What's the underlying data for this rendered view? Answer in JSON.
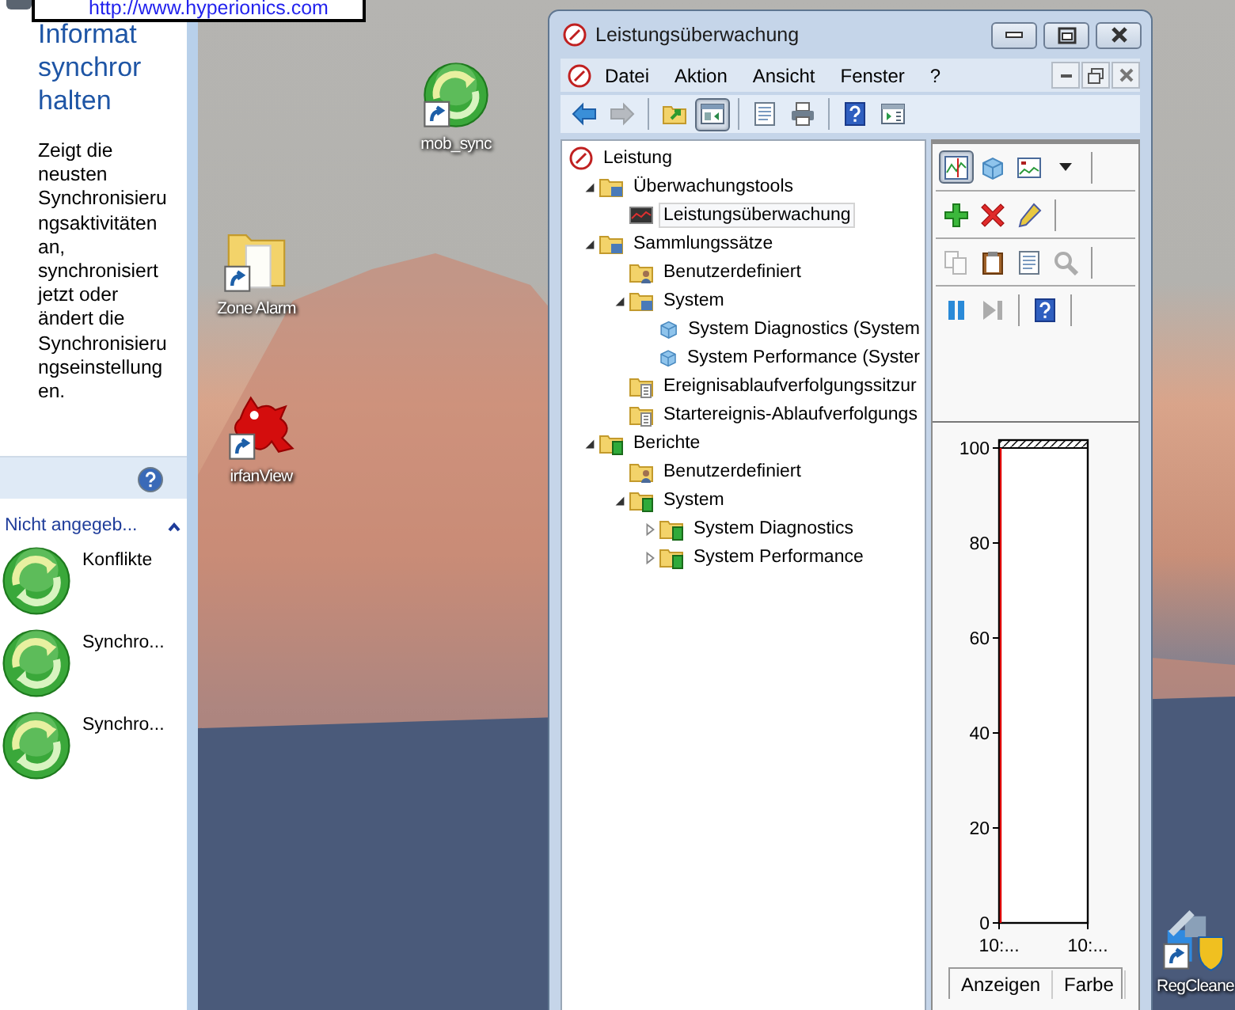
{
  "tooltip": {
    "text": "http://www.hyperionics.com"
  },
  "sync_panel": {
    "title": "Informat synchror halten",
    "description": "Zeigt die neusten Synchronisierungsaktivitäten an, synchronisiert jetzt oder ändert die Synchronisierungseinstellungen.",
    "group": {
      "label": "Nicht angegeb...",
      "expanded": true
    },
    "items": [
      {
        "label": "Konflikte"
      },
      {
        "label": "Synchro..."
      },
      {
        "label": "Synchro..."
      }
    ]
  },
  "desktop_icons": [
    {
      "label": "mob_sync",
      "kind": "sync"
    },
    {
      "label": "Zone Alarm",
      "kind": "folder"
    },
    {
      "label": "irfanView",
      "kind": "cat"
    },
    {
      "label": "RegCleane",
      "kind": "tools"
    }
  ],
  "window": {
    "title": "Leistungsüberwachung",
    "menu": [
      "Datei",
      "Aktion",
      "Ansicht",
      "Fenster",
      "?"
    ],
    "toolbar": [
      {
        "groups": [
          {
            "buttons": [
              {
                "kind": "back",
                "disabled": false,
                "pressed": false
              },
              {
                "kind": "forward",
                "disabled": true,
                "pressed": false
              }
            ]
          },
          {
            "buttons": [
              {
                "kind": "folderup",
                "disabled": false,
                "pressed": false
              },
              {
                "kind": "pane",
                "disabled": false,
                "pressed": true
              }
            ]
          },
          {
            "buttons": [
              {
                "kind": "doc",
                "disabled": false,
                "pressed": false
              },
              {
                "kind": "print",
                "disabled": false,
                "pressed": false
              }
            ]
          },
          {
            "buttons": [
              {
                "kind": "help",
                "disabled": false,
                "pressed": false
              },
              {
                "kind": "console",
                "disabled": false,
                "pressed": false
              }
            ]
          }
        ]
      }
    ],
    "tree": [
      {
        "label": "Leistung",
        "kind": "dial",
        "selected": false,
        "children": [
          {
            "label": "Überwachungstools",
            "kind": "folder",
            "expanded": true,
            "selected": false,
            "children": [
              {
                "label": "Leistungsüberwachung",
                "kind": "monitor",
                "selected": true
              }
            ]
          },
          {
            "label": "Sammlungssätze",
            "kind": "folder",
            "expanded": true,
            "selected": false,
            "children": [
              {
                "label": "Benutzerdefiniert",
                "kind": "user",
                "selected": false
              },
              {
                "label": "System",
                "kind": "folder",
                "expanded": true,
                "selected": false,
                "children": [
                  {
                    "label": "System Diagnostics (System",
                    "kind": "cube",
                    "selected": false
                  },
                  {
                    "label": "System Performance (Syster",
                    "kind": "cube",
                    "selected": false
                  }
                ]
              },
              {
                "label": "Ereignisablaufverfolgungssitzur",
                "kind": "log",
                "selected": false
              },
              {
                "label": "Startereignis-Ablaufverfolgungs",
                "kind": "log",
                "selected": false
              }
            ]
          },
          {
            "label": "Berichte",
            "kind": "report",
            "expanded": true,
            "selected": false,
            "children": [
              {
                "label": "Benutzerdefiniert",
                "kind": "user",
                "selected": false
              },
              {
                "label": "System",
                "kind": "report",
                "expanded": true,
                "selected": false,
                "children": [
                  {
                    "label": "System Diagnostics",
                    "kind": "report",
                    "expanded": false,
                    "selected": false
                  },
                  {
                    "label": "System Performance",
                    "kind": "report",
                    "expanded": false,
                    "selected": false
                  }
                ]
              }
            ]
          }
        ]
      }
    ],
    "action_toolbar": [
      {
        "groups": [
          {
            "buttons": [
              {
                "kind": "linechart",
                "disabled": false,
                "pressed": true
              },
              {
                "kind": "cube",
                "disabled": false,
                "pressed": false
              },
              {
                "kind": "histogram",
                "disabled": false,
                "pressed": false
              },
              {
                "kind": "caret",
                "disabled": false,
                "pressed": false
              }
            ]
          }
        ]
      },
      {
        "groups": [
          {
            "buttons": [
              {
                "kind": "plus",
                "disabled": false,
                "pressed": false
              },
              {
                "kind": "cross",
                "disabled": false,
                "pressed": false
              },
              {
                "kind": "pencil",
                "disabled": false,
                "pressed": false
              }
            ]
          }
        ]
      },
      {
        "groups": [
          {
            "buttons": [
              {
                "kind": "copy",
                "disabled": true,
                "pressed": false
              },
              {
                "kind": "clipboard",
                "disabled": false,
                "pressed": false
              },
              {
                "kind": "doc",
                "disabled": false,
                "pressed": false
              },
              {
                "kind": "magnifier",
                "disabled": true,
                "pressed": false
              }
            ]
          }
        ]
      },
      {
        "groups": [
          {
            "buttons": [
              {
                "kind": "pause",
                "disabled": false,
                "pressed": false
              },
              {
                "kind": "skip",
                "disabled": true,
                "pressed": false
              }
            ]
          },
          {
            "buttons": [
              {
                "kind": "help",
                "disabled": false,
                "pressed": false
              }
            ]
          }
        ]
      }
    ],
    "chart_data": {
      "type": "line",
      "categories": [
        "10:...",
        "10:..."
      ],
      "ylim": [
        0,
        100
      ],
      "yticks": [
        0,
        20,
        40,
        60,
        80,
        100
      ]
    },
    "legend_columns": [
      "Anzeigen",
      "Farbe"
    ]
  }
}
